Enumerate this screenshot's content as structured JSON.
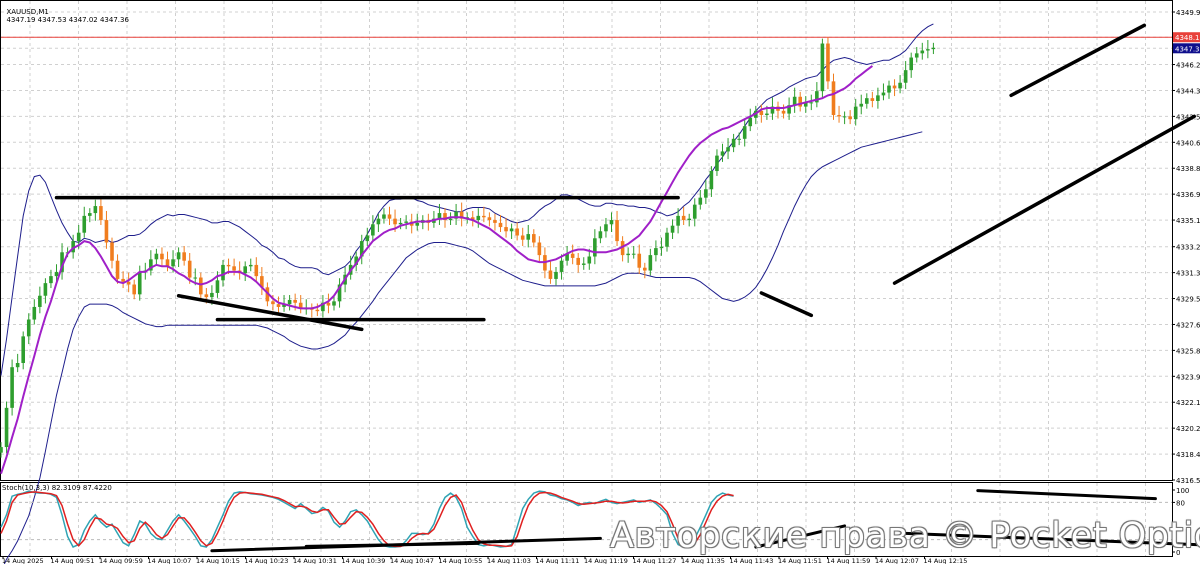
{
  "header": {
    "symbol": "XAUUSD,M1",
    "ohlc": "4347.19 4347.53 4347.02 4347.36"
  },
  "stoch_header": "Stoch(10,3,3) 82.3109 87.4220",
  "watermark": "Авторские права © Pocket Option",
  "price_axis": {
    "labels": [
      "4349.95",
      "4348.15",
      "4347.36",
      "4346.20",
      "4344.35",
      "4342.50",
      "4340.65",
      "4338.80",
      "4336.95",
      "4335.10",
      "4333.20",
      "4331.35",
      "4329.50",
      "4327.65",
      "4325.80",
      "4323.95",
      "4322.10",
      "4320.25",
      "4318.40",
      "4316.55"
    ],
    "highlight_levels": [
      {
        "price": 4348.15,
        "label": "4348.15",
        "color": "#e8403a"
      },
      {
        "price": 4347.36,
        "label": "4347.36",
        "color": "#0e0e8c"
      }
    ]
  },
  "stoch_axis": {
    "labels": [
      "100",
      "80",
      "0"
    ]
  },
  "time_axis": {
    "labels": [
      "14 Aug 2025",
      "14 Aug 09:51",
      "14 Aug 09:59",
      "14 Aug 10:07",
      "14 Aug 10:15",
      "14 Aug 10:23",
      "14 Aug 10:31",
      "14 Aug 10:39",
      "14 Aug 10:47",
      "14 Aug 10:55",
      "14 Aug 11:03",
      "14 Aug 11:11",
      "14 Aug 11:19",
      "14 Aug 11:27",
      "14 Aug 11:35",
      "14 Aug 11:43",
      "14 Aug 11:51",
      "14 Aug 11:59",
      "14 Aug 12:07",
      "14 Aug 12:15"
    ]
  },
  "colors": {
    "bull": "#2e9e2e",
    "bear": "#f07d1e",
    "bands": "#1e1e8c",
    "ma": "#a020c8",
    "stoch_main": "#2fa4b4",
    "stoch_signal": "#e02020"
  },
  "chart_data": {
    "type": "candlestick",
    "price_range": [
      4316.55,
      4349.95
    ],
    "stoch_range": [
      0,
      100
    ],
    "stoch_levels": [
      20,
      80
    ],
    "series": [
      {
        "name": "price",
        "values": [
          4318.9,
          4321.7,
          4324.6,
          4324.9,
          4326.8,
          4328.0,
          4328.9,
          4329.7,
          4330.6,
          4331.1,
          4331.4,
          4332.8,
          4332.8,
          4333.6,
          4334.2,
          4335.4,
          4335.6,
          4336.1,
          4335.1,
          4333.5,
          4332.2,
          4330.9,
          4330.7,
          4330.5,
          4329.8,
          4331.4,
          4331.5,
          4332.3,
          4332.7,
          4332.3,
          4331.8,
          4332.3,
          4332.8,
          4332.2,
          4331.0,
          4331.0,
          4329.8,
          4329.6,
          4329.9,
          4330.8,
          4331.9,
          4331.8,
          4331.5,
          4331.3,
          4331.8,
          4331.9,
          4331.1,
          4330.3,
          4329.3,
          4329.1,
          4328.9,
          4329.1,
          4329.4,
          4329.2,
          4328.8,
          4328.8,
          4328.7,
          4328.6,
          4329.2,
          4329.0,
          4329.3,
          4330.5,
          4331.2,
          4331.9,
          4332.5,
          4333.6,
          4334.0,
          4334.8,
          4335.2,
          4335.5,
          4335.2,
          4334.8,
          4334.9,
          4335.0,
          4334.7,
          4334.9,
          4335.1,
          4334.9,
          4335.2,
          4335.6,
          4335.1,
          4335.2,
          4335.7,
          4335.2,
          4335.3,
          4335.1,
          4335.4,
          4335.3,
          4335.1,
          4334.9,
          4334.6,
          4334.3,
          4334.5,
          4334.0,
          4333.7,
          4334.1,
          4333.5,
          4332.6,
          4331.5,
          4330.9,
          4331.4,
          4332.2,
          4332.7,
          4332.4,
          4331.9,
          4332.0,
          4332.5,
          4333.8,
          4334.3,
          4334.8,
          4335.1,
          4333.6,
          4332.6,
          4332.7,
          4332.7,
          4331.7,
          4331.5,
          4332.6,
          4333.1,
          4333.2,
          4334.2,
          4334.7,
          4335.4,
          4335.1,
          4335.2,
          4336.2,
          4336.7,
          4337.3,
          4338.6,
          4339.7,
          4340.0,
          4340.3,
          4340.9,
          4340.9,
          4341.8,
          4342.4,
          4342.9,
          4342.6,
          4342.7,
          4343.2,
          4342.9,
          4342.7,
          4343.3,
          4343.9,
          4343.2,
          4343.5,
          4343.5,
          4344.3,
          4347.7,
          4345.0,
          4342.6,
          4342.5,
          4342.5,
          4342.3,
          4343.2,
          4343.4,
          4343.8,
          4343.6,
          4344.0,
          4344.2,
          4344.7,
          4344.5,
          4344.9,
          4345.8,
          4346.7,
          4347.0,
          4347.2,
          4347.3,
          4347.4
        ]
      },
      {
        "name": "upper band",
        "values": [
          4324.0,
          4326.6,
          4329.6,
          4332.5,
          4335.4,
          4337.2,
          4338.2,
          4338.3,
          4337.8,
          4336.8,
          4335.8,
          4334.9,
          4334.2,
          4333.6,
          4333.5,
          4333.8,
          4333.7,
          4333.5,
          4333.6,
          4333.7,
          4333.5,
          4333.6,
          4333.8,
          4334.0,
          4334.0,
          4334.1,
          4334.4,
          4334.8,
          4335.1,
          4335.3,
          4335.5,
          4335.4,
          4335.5,
          4335.5,
          4335.4,
          4335.3,
          4335.2,
          4335.1,
          4334.9,
          4334.9,
          4335.0,
          4335.0,
          4334.8,
          4334.6,
          4334.3,
          4334.0,
          4333.7,
          4333.3,
          4333.1,
          4332.8,
          4332.4,
          4332.3,
          4332.0,
          4331.8,
          4331.7,
          4331.7,
          4331.7,
          4331.6,
          4331.3,
          4331.2,
          4331.4,
          4331.6,
          4331.8,
          4332.2,
          4332.9,
          4333.4,
          4334.1,
          4334.8,
          4335.6,
          4336.1,
          4336.5,
          4336.6,
          4336.6,
          4336.7,
          4336.7,
          4336.5,
          4336.4,
          4336.2,
          4336.1,
          4336.0,
          4335.9,
          4335.8,
          4335.7,
          4335.7,
          4335.9,
          4336.0,
          4336.0,
          4336.0,
          4335.9,
          4335.6,
          4335.4,
          4335.2,
          4335.0,
          4334.9,
          4335.0,
          4335.1,
          4335.4,
          4335.8,
          4336.1,
          4336.3,
          4336.6,
          4336.9,
          4336.9,
          4336.8,
          4336.6,
          4336.4,
          4336.2,
          4336.1,
          4336.1,
          4336.3,
          4336.3,
          4336.2,
          4336.2,
          4336.1,
          4336.1,
          4336.0,
          4336.0,
          4335.9,
          4335.7,
          4335.6,
          4335.4,
          4335.5,
          4335.7,
          4336.1,
          4336.4,
          4336.9,
          4337.4,
          4338.0,
          4338.5,
          4339.1,
          4339.6,
          4340.2,
          4340.7,
          4341.2,
          4341.8,
          4342.4,
          4342.9,
          4343.3,
          4343.7,
          4343.9,
          4344.1,
          4344.3,
          4344.6,
          4344.8,
          4345.0,
          4345.2,
          4345.3,
          4345.4,
          4345.8,
          4346.2,
          4346.5,
          4346.6,
          4346.7,
          4346.6,
          4346.4,
          4346.3,
          4346.2,
          4346.3,
          4346.4,
          4346.5,
          4346.5,
          4346.7,
          4346.9,
          4347.2,
          4347.7,
          4348.2,
          4348.6,
          4348.9,
          4349.1
        ]
      },
      {
        "name": "lower band",
        "values": [
          4310.0,
          4310.9,
          4311.5,
          4312.2,
          4313.1,
          4314.0,
          4315.3,
          4316.7,
          4318.6,
          4320.6,
          4322.6,
          4324.2,
          4325.9,
          4327.3,
          4328.2,
          4328.9,
          4329.1,
          4329.1,
          4329.1,
          4329.1,
          4329.0,
          4328.8,
          4328.5,
          4328.3,
          4328.1,
          4327.9,
          4327.7,
          4327.6,
          4327.5,
          4327.5,
          4327.6,
          4327.6,
          4327.6,
          4327.6,
          4327.6,
          4327.6,
          4327.6,
          4327.6,
          4327.6,
          4327.6,
          4327.6,
          4327.6,
          4327.6,
          4327.6,
          4327.6,
          4327.6,
          4327.6,
          4327.5,
          4327.4,
          4327.2,
          4327.0,
          4326.8,
          4326.5,
          4326.3,
          4326.1,
          4326.0,
          4325.9,
          4325.9,
          4326.0,
          4326.1,
          4326.3,
          4326.6,
          4326.9,
          4327.4,
          4327.8,
          4328.3,
          4328.8,
          4329.3,
          4329.9,
          4330.4,
          4330.9,
          4331.4,
          4331.9,
          4332.4,
          4332.7,
          4333.0,
          4333.2,
          4333.4,
          4333.5,
          4333.5,
          4333.5,
          4333.4,
          4333.3,
          4333.2,
          4333.1,
          4332.9,
          4332.6,
          4332.3,
          4332.0,
          4331.8,
          4331.6,
          4331.4,
          4331.2,
          4331.0,
          4330.8,
          4330.7,
          4330.6,
          4330.5,
          4330.4,
          4330.4,
          4330.4,
          4330.4,
          4330.4,
          4330.4,
          4330.4,
          4330.4,
          4330.4,
          4330.4,
          4330.5,
          4330.6,
          4330.8,
          4331.0,
          4331.2,
          4331.3,
          4331.3,
          4331.3,
          4331.2,
          4331.1,
          4331.0,
          4331.0,
          4331.0,
          4331.0,
          4331.0,
          4331.0,
          4331.0,
          4330.9,
          4330.7,
          4330.4,
          4330.1,
          4329.8,
          4329.5,
          4329.4,
          4329.3,
          4329.4,
          4329.6,
          4329.9,
          4330.3,
          4330.9,
          4331.6,
          4332.4,
          4333.3,
          4334.3,
          4335.2,
          4336.1,
          4336.9,
          4337.6,
          4338.2,
          4338.6,
          4338.9,
          4339.1,
          4339.3,
          4339.5,
          4339.7,
          4339.9,
          4340.1,
          4340.3,
          4340.4,
          4340.5,
          4340.6,
          4340.7,
          4340.8,
          4340.9,
          4341.0,
          4341.1,
          4341.2,
          4341.3,
          4341.4
        ]
      },
      {
        "name": "ma",
        "values": [
          4317.0,
          4318.2,
          4319.6,
          4320.9,
          4322.5,
          4324.0,
          4325.4,
          4326.9,
          4328.2,
          4329.3,
          4330.6,
          4331.8,
          4332.7,
          4333.1,
          4333.3,
          4333.6,
          4333.5,
          4333.1,
          4332.5,
          4331.8,
          4331.1,
          4330.7,
          4330.6,
          4330.8,
          4331.1,
          4331.4,
          4331.4,
          4331.7,
          4331.9,
          4331.8,
          4331.8,
          4331.6,
          4331.3,
          4331.1,
          4330.8,
          4330.6,
          4330.5,
          4330.6,
          4330.8,
          4331.1,
          4331.2,
          4331.4,
          4331.4,
          4331.4,
          4331.2,
          4331.0,
          4330.7,
          4330.3,
          4329.9,
          4329.5,
          4329.2,
          4329.1,
          4329.0,
          4328.9,
          4328.8,
          4328.8,
          4328.8,
          4328.9,
          4329.1,
          4329.3,
          4329.7,
          4330.3,
          4330.9,
          4331.5,
          4332.0,
          4332.6,
          4333.1,
          4333.6,
          4333.9,
          4334.2,
          4334.4,
          4334.5,
          4334.7,
          4334.8,
          4334.9,
          4335.0,
          4335.0,
          4335.0,
          4335.1,
          4335.2,
          4335.2,
          4335.3,
          4335.3,
          4335.3,
          4335.2,
          4335.1,
          4334.9,
          4334.7,
          4334.5,
          4334.2,
          4333.9,
          4333.6,
          4333.3,
          4332.9,
          4332.6,
          4332.3,
          4332.2,
          4332.1,
          4332.1,
          4332.2,
          4332.3,
          4332.5,
          4332.7,
          4332.9,
          4333.0,
          4333.0,
          4332.9,
          4332.8,
          4332.8,
          4332.8,
          4332.9,
          4333.0,
          4333.2,
          4333.4,
          4333.7,
          4334.0,
          4334.5,
          4335.0,
          4335.7,
          4336.4,
          4337.1,
          4337.8,
          4338.5,
          4339.1,
          4339.7,
          4340.2,
          4340.6,
          4340.9,
          4341.2,
          4341.4,
          4341.6,
          4341.7,
          4341.9,
          4342.1,
          4342.3,
          4342.5,
          4342.7,
          4343.0,
          4343.1,
          4343.1,
          4343.1,
          4343.1,
          4343.2,
          4343.3,
          4343.4,
          4343.5,
          4343.6,
          4343.7,
          4343.8,
          4344.0,
          4344.1,
          4344.3,
          4344.5,
          4344.8,
          4345.2,
          4345.5,
          4345.8,
          4346.1
        ]
      }
    ],
    "stochastic": [
      {
        "name": "main",
        "values": [
          40,
          60,
          90,
          93,
          95,
          98,
          96,
          95,
          95,
          93,
          88,
          60,
          25,
          8,
          12,
          35,
          50,
          60,
          48,
          40,
          45,
          30,
          15,
          10,
          28,
          50,
          45,
          30,
          22,
          20,
          35,
          50,
          60,
          50,
          38,
          25,
          10,
          8,
          20,
          40,
          60,
          82,
          95,
          97,
          96,
          94,
          93,
          92,
          90,
          88,
          85,
          80,
          75,
          70,
          78,
          70,
          62,
          64,
          72,
          66,
          48,
          40,
          50,
          65,
          68,
          60,
          50,
          35,
          20,
          10,
          8,
          8,
          9,
          18,
          30,
          30,
          28,
          30,
          45,
          70,
          88,
          95,
          88,
          70,
          40,
          25,
          12,
          10,
          12,
          10,
          8,
          9,
          12,
          40,
          70,
          85,
          95,
          98,
          97,
          92,
          90,
          86,
          84,
          80,
          75,
          78,
          80,
          78,
          82,
          85,
          80,
          78,
          80,
          82,
          84,
          80,
          82,
          84,
          78,
          70,
          60,
          30,
          12,
          8,
          10,
          22,
          40,
          60,
          80,
          90,
          95,
          92,
          90
        ]
      },
      {
        "name": "signal",
        "values": [
          30,
          50,
          80,
          92,
          94,
          96,
          97,
          96,
          95,
          94,
          91,
          75,
          45,
          20,
          10,
          20,
          40,
          55,
          53,
          45,
          43,
          38,
          25,
          15,
          18,
          38,
          48,
          40,
          28,
          22,
          28,
          42,
          55,
          55,
          45,
          32,
          18,
          10,
          14,
          30,
          50,
          72,
          88,
          95,
          96,
          95,
          94,
          93,
          91,
          89,
          87,
          83,
          78,
          73,
          74,
          72,
          66,
          64,
          68,
          68,
          56,
          45,
          46,
          56,
          65,
          64,
          56,
          45,
          30,
          18,
          10,
          9,
          9,
          12,
          22,
          28,
          30,
          29,
          37,
          55,
          75,
          88,
          92,
          80,
          55,
          35,
          20,
          13,
          11,
          11,
          10,
          9,
          10,
          25,
          52,
          75,
          88,
          95,
          96,
          95,
          92,
          88,
          85,
          82,
          78,
          77,
          78,
          79,
          80,
          82,
          82,
          80,
          79,
          80,
          82,
          82,
          82,
          83,
          81,
          75,
          65,
          45,
          22,
          12,
          9,
          14,
          28,
          48,
          68,
          82,
          90,
          93,
          91
        ]
      }
    ],
    "trendlines": [
      {
        "from": [
          10,
          4336.7
        ],
        "to": [
          122,
          4336.7
        ]
      },
      {
        "from": [
          39,
          4328.0
        ],
        "to": [
          87,
          4328.0
        ]
      },
      {
        "from": [
          32,
          4329.7
        ],
        "to": [
          65,
          4327.3
        ]
      },
      {
        "from": [
          137,
          4329.9
        ],
        "to": [
          146,
          4328.3
        ]
      },
      {
        "from": [
          161,
          4330.6
        ],
        "to": [
          215,
          4342.5
        ]
      },
      {
        "from": [
          182,
          4344.0
        ],
        "to": [
          206,
          4349.0
        ]
      }
    ],
    "stoch_trendlines": [
      {
        "from": [
          38,
          2
        ],
        "to": [
          108,
          22
        ]
      },
      {
        "from": [
          55,
          9
        ],
        "to": [
          86,
          14
        ]
      },
      {
        "from": [
          136,
          8
        ],
        "to": [
          152,
          42
        ]
      },
      {
        "from": [
          163,
          30
        ],
        "to": [
          238,
          4
        ]
      },
      {
        "from": [
          176,
          99
        ],
        "to": [
          208,
          86
        ]
      }
    ]
  }
}
